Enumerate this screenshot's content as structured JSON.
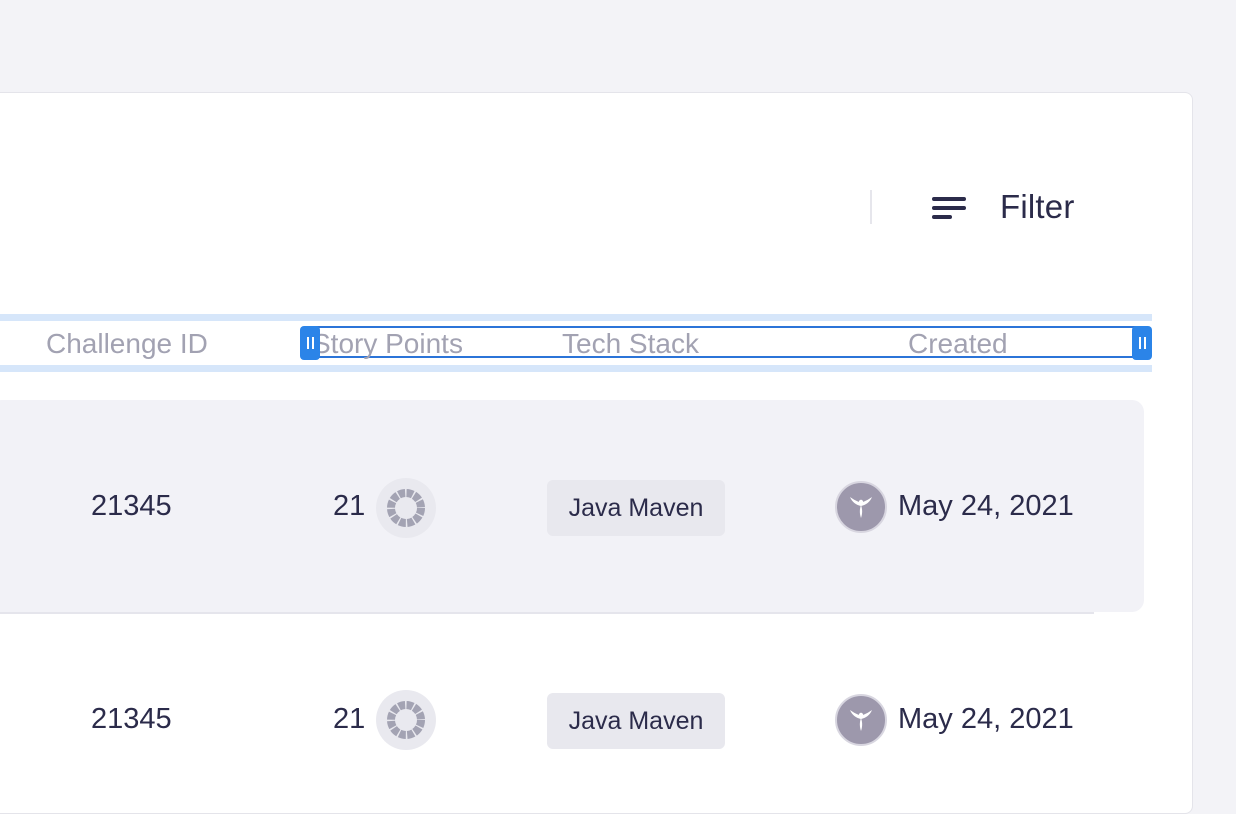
{
  "toolbar": {
    "filter_label": "Filter",
    "filter_icon": "filter-lines-icon"
  },
  "table": {
    "columns": [
      "Challenge ID",
      "Story Points",
      "Tech Stack",
      "Created"
    ],
    "rows": [
      {
        "challenge_id": "21345",
        "story_points": "21",
        "tech_stack": "Java Maven",
        "created": "May 24, 2021",
        "selected": true
      },
      {
        "challenge_id": "21345",
        "story_points": "21",
        "tech_stack": "Java Maven",
        "created": "May 24, 2021",
        "selected": false
      }
    ]
  },
  "colors": {
    "accent": "#2b84e8",
    "header_band": "#d6e6fa",
    "row_highlight": "#f2f2f7",
    "text": "#2b2b4a",
    "muted": "#a2a2b2"
  }
}
